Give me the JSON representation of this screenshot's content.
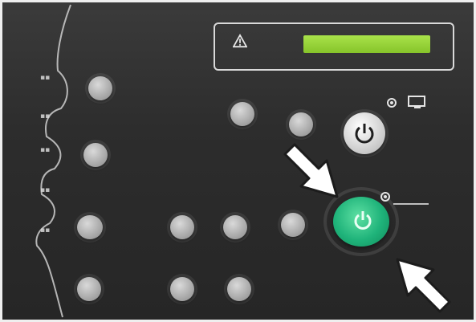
{
  "scene": {
    "type": "photo",
    "subject": "control panel"
  },
  "panel": {
    "lcd_color": "#99d33a",
    "warning_icon": "warning-triangle-icon",
    "power_icon": "power-icon",
    "arrows": "white-arrow-icon"
  },
  "colors": {
    "panel_bg": "#2f2f2f",
    "button_gray": "#b5b5b5",
    "power_green": "#1fb37a",
    "lcd_green": "#99d33a"
  }
}
